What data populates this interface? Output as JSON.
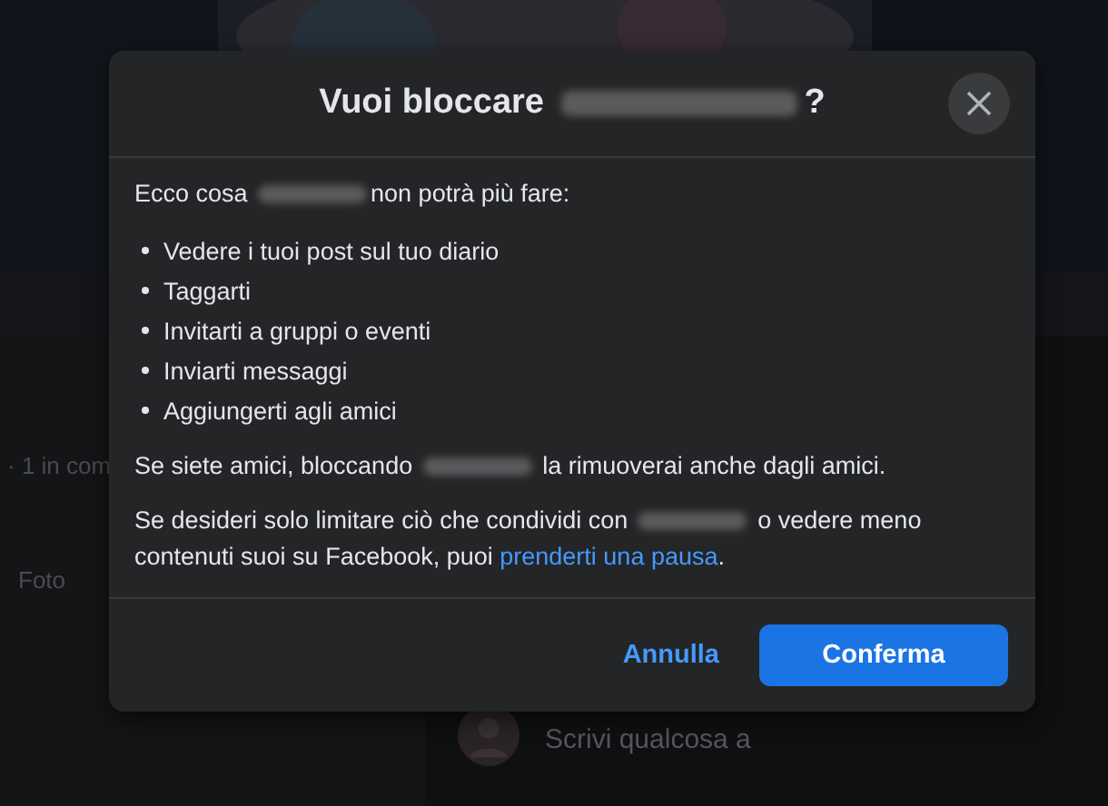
{
  "page": {
    "stats": "· 1 in com",
    "tab": "Foto",
    "composer_placeholder": "Scrivi qualcosa a"
  },
  "dialog": {
    "title": [
      {
        "kind": "text",
        "text": "Vuoi bloccare "
      },
      {
        "kind": "redacted"
      },
      {
        "kind": "text",
        "text": "?"
      }
    ],
    "intro": [
      {
        "kind": "text",
        "text": "Ecco cosa "
      },
      {
        "kind": "redacted"
      },
      {
        "kind": "text",
        "text": "non potrà più fare:"
      }
    ],
    "items": [
      "Vedere i tuoi post sul tuo diario",
      "Taggarti",
      "Invitarti a gruppi o eventi",
      "Inviarti messaggi",
      "Aggiungerti agli amici"
    ],
    "paragraphs": [
      [
        {
          "kind": "text",
          "text": "Se siete amici, bloccando "
        },
        {
          "kind": "redacted"
        },
        {
          "kind": "text",
          "text": " la rimuoverai anche dagli amici."
        }
      ],
      [
        {
          "kind": "text",
          "text": "Se desideri solo limitare ciò che condividi con "
        },
        {
          "kind": "redacted"
        },
        {
          "kind": "text",
          "text": " o vedere meno contenuti suoi su Facebook, puoi "
        },
        {
          "kind": "link",
          "text": "prenderti una pausa"
        },
        {
          "kind": "text",
          "text": "."
        }
      ]
    ],
    "cancel": "Annulla",
    "confirm": "Conferma"
  }
}
